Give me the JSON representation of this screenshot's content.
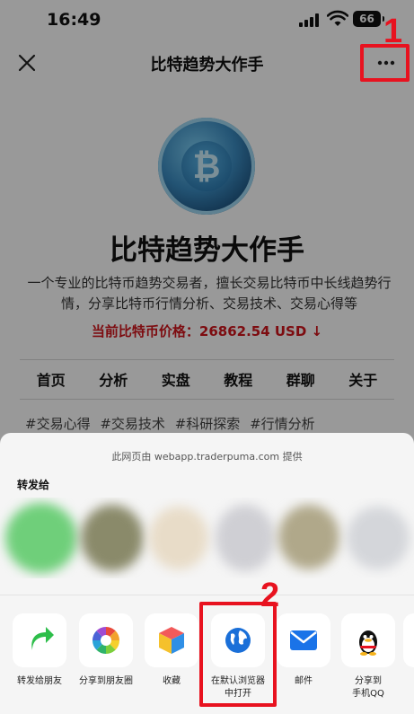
{
  "status_bar": {
    "time": "16:49",
    "battery": "66"
  },
  "nav": {
    "title": "比特趋势大作手"
  },
  "markers": {
    "first": "1",
    "second": "2"
  },
  "profile": {
    "title": "比特趋势大作手",
    "description": "一个专业的比特币趋势交易者，擅长交易比特币中长线趋势行情，分享比特币行情分析、交易技术、交易心得等",
    "price_text": "当前比特币价格：26862.54 USD ↓",
    "price_color": "#d0141c"
  },
  "menu": [
    "首页",
    "分析",
    "实盘",
    "教程",
    "群聊",
    "关于"
  ],
  "tags": [
    "#交易心得",
    "#交易技术",
    "#科研探索",
    "#行情分析"
  ],
  "sheet": {
    "provider": "此网页由 webapp.traderpuma.com 提供",
    "forward_label": "转发给",
    "actions": [
      {
        "label": "转发给朋友",
        "icon": "share-arrow-icon"
      },
      {
        "label": "分享到朋友圈",
        "icon": "moments-icon"
      },
      {
        "label": "收藏",
        "icon": "favorite-cube-icon"
      },
      {
        "label": "在默认浏览器\n中打开",
        "icon": "browser-globe-icon"
      },
      {
        "label": "邮件",
        "icon": "mail-icon"
      },
      {
        "label": "分享到\n手机QQ",
        "icon": "qq-penguin-icon"
      }
    ]
  },
  "colors": {
    "marker": "#e8121f",
    "share_green": "#2dbe4a",
    "browser_blue": "#1a6fd8",
    "mail_blue": "#1a73e8"
  }
}
